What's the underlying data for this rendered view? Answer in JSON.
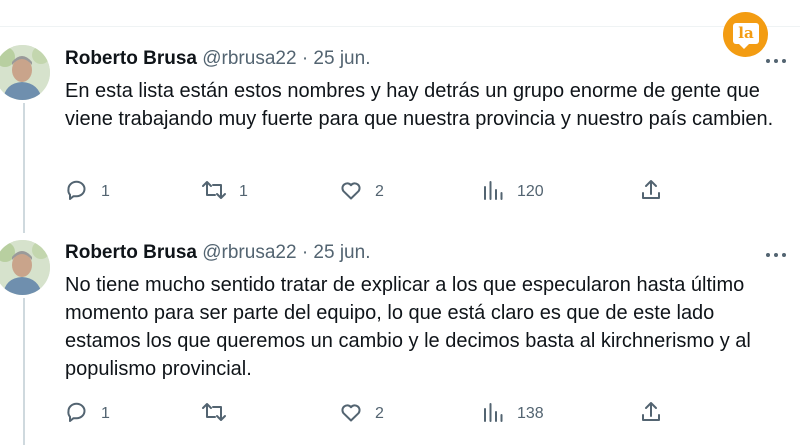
{
  "brand": {
    "logo_text": "la",
    "color": "#f39c12"
  },
  "tweets": [
    {
      "author_name": "Roberto Brusa",
      "handle": "@rbrusa22",
      "separator": "·",
      "date": "25 jun.",
      "text": "En esta lista están estos nombres y hay detrás un grupo enorme de gente que viene trabajando muy fuerte para que nuestra provincia y nuestro país cambien.",
      "replies": "1",
      "retweets": "1",
      "likes": "2",
      "views": "120"
    },
    {
      "author_name": "Roberto Brusa",
      "handle": "@rbrusa22",
      "separator": "·",
      "date": "25 jun.",
      "text": "No tiene mucho sentido tratar de explicar a los que especularon hasta último momento para ser parte del equipo, lo que está claro es que de este lado estamos los que queremos un cambio y le decimos basta al kirchnerismo y al populismo provincial.",
      "replies": "1",
      "retweets": "",
      "likes": "2",
      "views": "138"
    }
  ],
  "icons": [
    "reply-icon",
    "retweet-icon",
    "like-icon",
    "views-icon",
    "share-icon",
    "more-icon"
  ],
  "colors": {
    "text": "#0f1419",
    "muted": "#536471",
    "thread_line": "#cfd9de"
  }
}
